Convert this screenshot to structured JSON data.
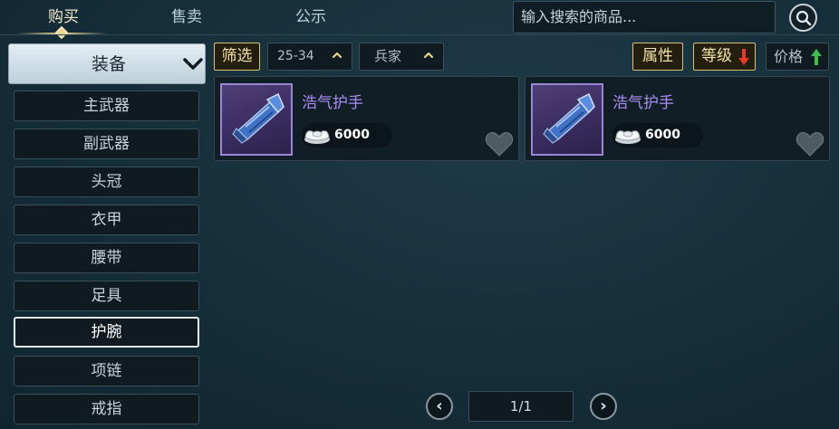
{
  "tabs": [
    {
      "label": "购买",
      "active": true
    },
    {
      "label": "售卖",
      "active": false
    },
    {
      "label": "公示",
      "active": false
    }
  ],
  "search": {
    "placeholder": "输入搜索的商品..."
  },
  "category_dropdown": {
    "label": "装备"
  },
  "categories": [
    {
      "label": "主武器"
    },
    {
      "label": "副武器"
    },
    {
      "label": "头冠"
    },
    {
      "label": "衣甲"
    },
    {
      "label": "腰带"
    },
    {
      "label": "足具"
    },
    {
      "label": "护腕",
      "active": true
    },
    {
      "label": "项链"
    },
    {
      "label": "戒指"
    }
  ],
  "filters": {
    "label": "筛选",
    "level_range": "25-34",
    "class": "兵家"
  },
  "sort": {
    "attribute": "属性",
    "level": "等级",
    "level_direction": "descending",
    "price": "价格",
    "price_direction": "ascending"
  },
  "items": [
    {
      "name": "浩气护手",
      "price": "6000",
      "currency_icon": "silver-ingot-icon"
    },
    {
      "name": "浩气护手",
      "price": "6000",
      "currency_icon": "silver-ingot-icon"
    }
  ],
  "pagination": {
    "current": "1/1"
  },
  "colors": {
    "accent_gold": "#d8c275",
    "item_name_purple": "#a98df2",
    "sort_down_red": "#e8382a",
    "sort_up_green": "#3fbf4a"
  }
}
